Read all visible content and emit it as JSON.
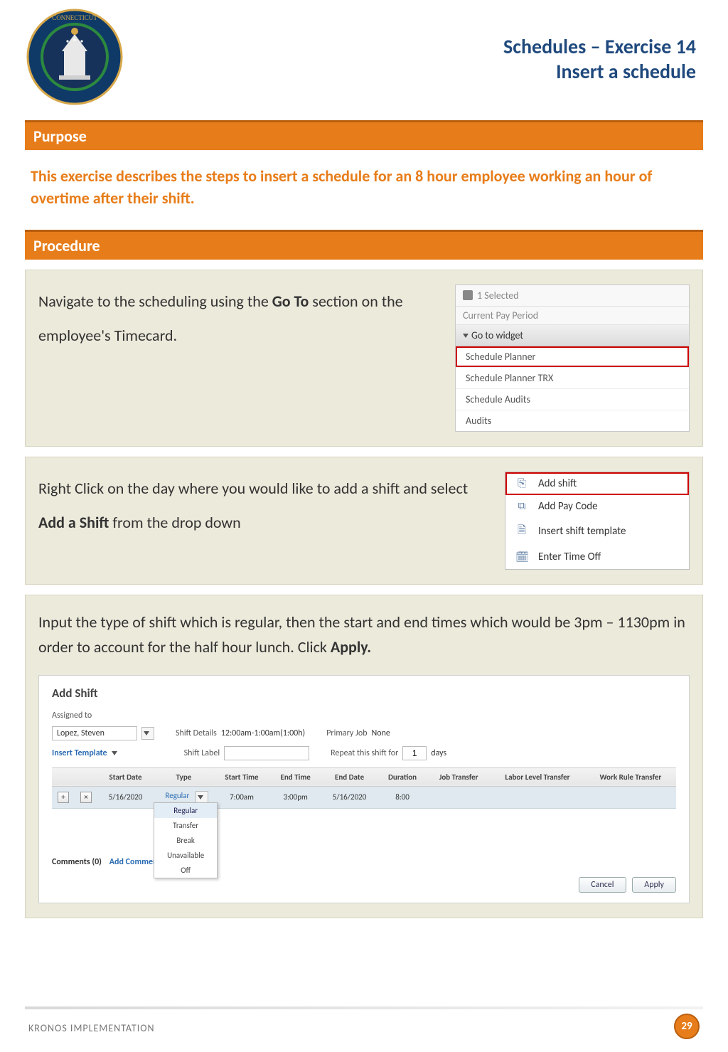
{
  "header": {
    "title_line1": "Schedules – Exercise 14",
    "title_line2": "Insert a schedule"
  },
  "sections": {
    "purpose_label": "Purpose",
    "procedure_label": "Procedure"
  },
  "purpose_text": "This exercise describes the steps to insert a schedule for an 8 hour employee working an hour of overtime after their shift.",
  "step1": {
    "pre": "Navigate to the scheduling using the ",
    "bold": "Go To",
    "post": " section on the employee's Timecard.",
    "widget": {
      "selected": "1 Selected",
      "current": "Current Pay Period",
      "goto": "Go to widget",
      "items": [
        "Schedule Planner",
        "Schedule Planner TRX",
        "Schedule Audits",
        "Audits"
      ]
    }
  },
  "step2": {
    "pre": "Right Click on the day where you would like to add a shift and select ",
    "bold": "Add a Shift",
    "post": " from the drop down",
    "menu": [
      {
        "icon": "add-shift-icon",
        "label": "Add shift"
      },
      {
        "icon": "add-paycode-icon",
        "label": "Add Pay Code"
      },
      {
        "icon": "insert-template-icon",
        "label": "Insert shift template"
      },
      {
        "icon": "time-off-icon",
        "label": "Enter Time Off"
      }
    ]
  },
  "step3": {
    "pre": "Input the type of shift which is regular, then the start and end times which would be 3pm – 1130pm in order to account for the half hour lunch. Click ",
    "bold": "Apply.",
    "dialog": {
      "title": "Add Shift",
      "assigned_label": "Assigned to",
      "assigned_value": "Lopez, Steven",
      "shift_details_label": "Shift Details",
      "shift_details_value": "12:00am-1:00am(1:00h)",
      "primary_job_label": "Primary Job",
      "primary_job_value": "None",
      "insert_template": "Insert Template",
      "shift_label_label": "Shift Label",
      "repeat_label": "Repeat this shift for",
      "repeat_value": "1",
      "repeat_suffix": "days",
      "columns": [
        "",
        "",
        "Start Date",
        "Type",
        "Start Time",
        "End Time",
        "End Date",
        "Duration",
        "Job Transfer",
        "Labor Level Transfer",
        "Work Rule Transfer"
      ],
      "row": {
        "start_date": "5/16/2020",
        "type": "Regular",
        "start_time": "7:00am",
        "end_time": "3:00pm",
        "end_date": "5/16/2020",
        "duration": "8:00"
      },
      "type_options": [
        "Regular",
        "Transfer",
        "Break",
        "Unavailable",
        "Off"
      ],
      "comments_label": "Comments (0)",
      "add_comment_link": "Add Comment",
      "btn_cancel": "Cancel",
      "btn_apply": "Apply"
    }
  },
  "footer": {
    "text": "KRONOS IMPLEMENTATION",
    "page": "29"
  }
}
